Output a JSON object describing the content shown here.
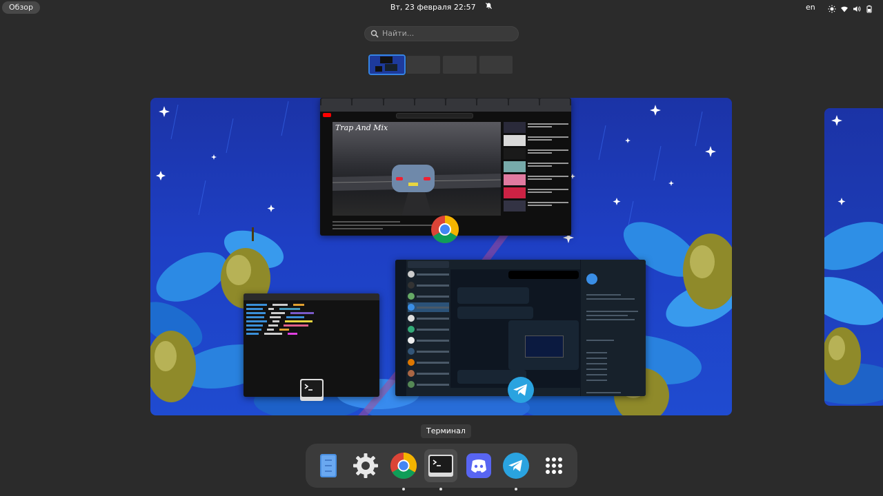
{
  "topbar": {
    "activities_label": "Обзор",
    "datetime": "Вт, 23 февраля  22:57",
    "keyboard_layout": "en"
  },
  "search": {
    "placeholder": "Найти..."
  },
  "windows": {
    "chrome": {
      "video_title": "Trap And Mix"
    }
  },
  "hover_caption": "Терминал",
  "dash": {
    "items": [
      {
        "name": "Files",
        "icon": "files-icon",
        "running": false
      },
      {
        "name": "Settings",
        "icon": "gear-icon",
        "running": false
      },
      {
        "name": "Google Chrome",
        "icon": "chrome-icon",
        "running": true
      },
      {
        "name": "Terminal",
        "icon": "terminal-icon",
        "running": true
      },
      {
        "name": "Discord",
        "icon": "discord-icon",
        "running": false
      },
      {
        "name": "Telegram",
        "icon": "telegram-icon",
        "running": true
      },
      {
        "name": "Show Applications",
        "icon": "app-grid-icon",
        "running": false
      }
    ]
  },
  "colors": {
    "accent": "#3584e4",
    "panel_bg": "#2b2b2b",
    "dash_bg": "#3b3b3b"
  }
}
